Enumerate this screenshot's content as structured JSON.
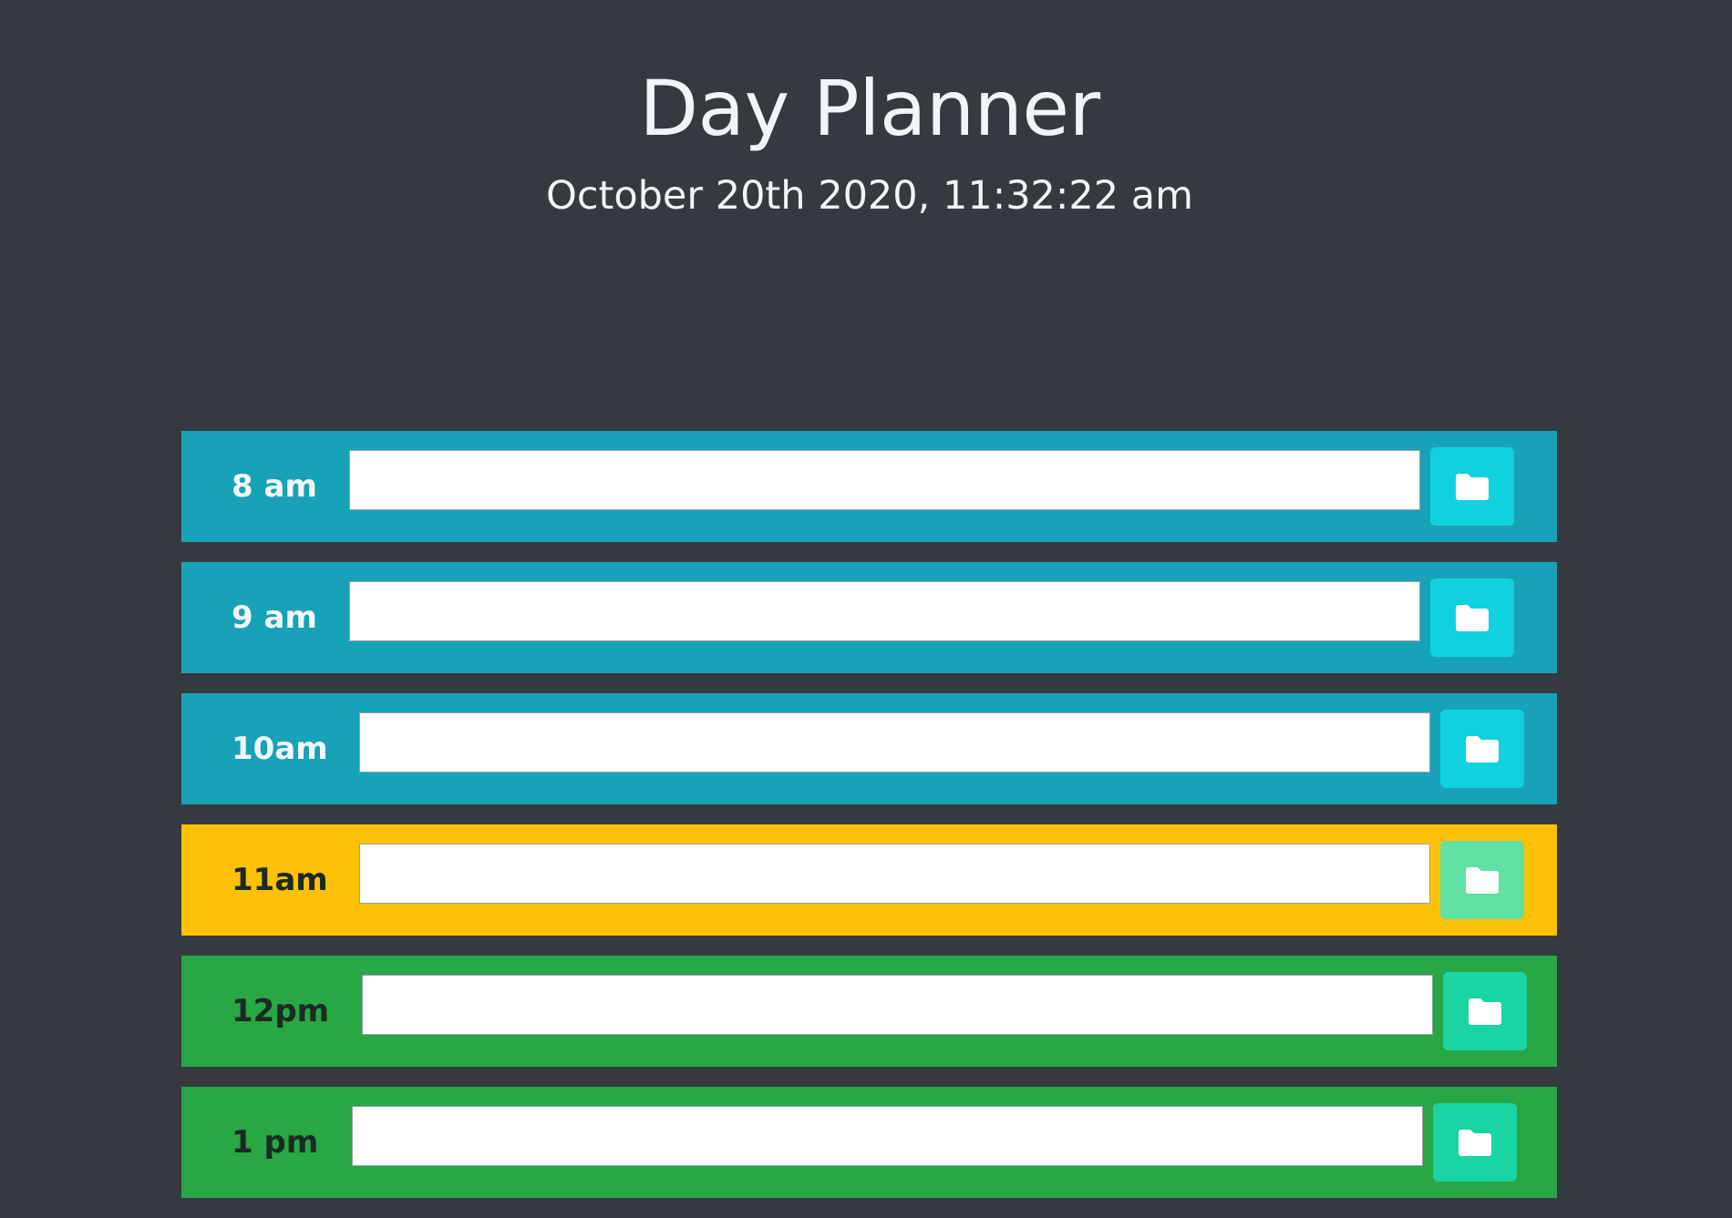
{
  "header": {
    "title": "Day Planner",
    "datetime": "October 20th 2020, 11:32:22 am"
  },
  "colors": {
    "background": "#343a40",
    "past": "#17a2b8",
    "present": "#ffc107",
    "future": "#28a745",
    "save_past": "#0fd2de",
    "save_present": "#60e0a2",
    "save_future": "#1ad4a4"
  },
  "hours": [
    {
      "label": "8 am",
      "status": "past",
      "task": "",
      "save_icon": "folder-icon"
    },
    {
      "label": "9 am",
      "status": "past",
      "task": "",
      "save_icon": "folder-icon"
    },
    {
      "label": "10am",
      "status": "past",
      "task": "",
      "save_icon": "folder-icon"
    },
    {
      "label": "11am",
      "status": "present",
      "task": "",
      "save_icon": "folder-icon"
    },
    {
      "label": "12pm",
      "status": "future",
      "task": "",
      "save_icon": "folder-icon"
    },
    {
      "label": "1 pm",
      "status": "future",
      "task": "",
      "save_icon": "folder-icon"
    }
  ]
}
